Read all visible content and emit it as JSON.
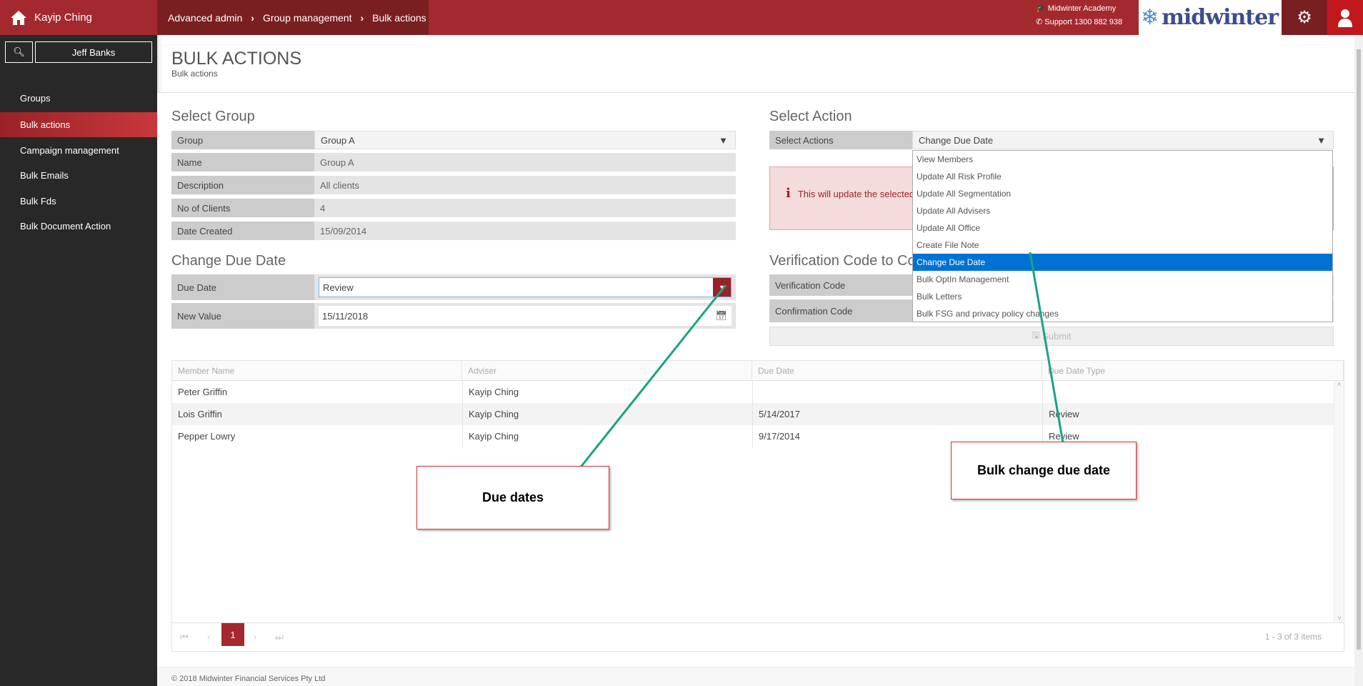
{
  "header": {
    "user": "Kayip Ching",
    "breadcrumbs": [
      "Advanced admin",
      "Group management",
      "Bulk actions"
    ],
    "academy": "Midwinter Academy",
    "support": "Support 1300 882 938",
    "logo_text": "midwinter"
  },
  "sidebar": {
    "search_name": "Jeff Banks",
    "items": [
      {
        "label": "Groups"
      },
      {
        "label": "Bulk actions",
        "active": true
      },
      {
        "label": "Campaign management"
      },
      {
        "label": "Bulk Emails"
      },
      {
        "label": "Bulk Fds"
      },
      {
        "label": "Bulk Document Action"
      }
    ]
  },
  "page": {
    "title": "BULK ACTIONS",
    "subtitle": "Bulk actions"
  },
  "select_group": {
    "heading": "Select Group",
    "rows": [
      {
        "label": "Group",
        "value": "Group A"
      },
      {
        "label": "Name",
        "value": "Group A"
      },
      {
        "label": "Description",
        "value": "All clients"
      },
      {
        "label": "No of Clients",
        "value": "4"
      },
      {
        "label": "Date Created",
        "value": "15/09/2014"
      }
    ]
  },
  "change_due_date": {
    "heading": "Change Due Date",
    "due_date_label": "Due Date",
    "due_date_value": "Review",
    "new_value_label": "New Value",
    "new_value": "15/11/2018"
  },
  "select_action": {
    "heading": "Select Action",
    "label": "Select Actions",
    "value": "Change Due Date",
    "alert": "This will update the selected",
    "options": [
      "View Members",
      "Update All Risk Profile",
      "Update All Segmentation",
      "Update All Advisers",
      "Update All Office",
      "Create File Note",
      "Change Due Date",
      "Bulk OptIn Management",
      "Bulk Letters",
      "Bulk FSG and privacy policy changes"
    ],
    "highlighted": "Change Due Date"
  },
  "verification": {
    "heading": "Verification Code to Co",
    "verification_label": "Verification Code",
    "confirmation_label": "Confirmation Code",
    "submit": "Submit"
  },
  "grid": {
    "columns": [
      "Member Name",
      "Adviser",
      "Due Date",
      "Due Date Type"
    ],
    "rows": [
      [
        "Peter Griffin",
        "Kayip Ching",
        "",
        ""
      ],
      [
        "Lois Griffin",
        "Kayip Ching",
        "5/14/2017",
        "Review"
      ],
      [
        "Pepper Lowry",
        "Kayip Ching",
        "9/17/2014",
        "Review"
      ]
    ],
    "page": "1",
    "summary": "1 - 3 of 3 items"
  },
  "footer": "© 2018 Midwinter Financial Services Pty Ltd",
  "annotations": {
    "due_dates": "Due dates",
    "bulk_change": "Bulk change due date"
  },
  "colors": {
    "brand": "#a4292e",
    "dark_brand": "#7a1f21",
    "highlight": "#0072d4",
    "arrow": "#1aa383"
  }
}
